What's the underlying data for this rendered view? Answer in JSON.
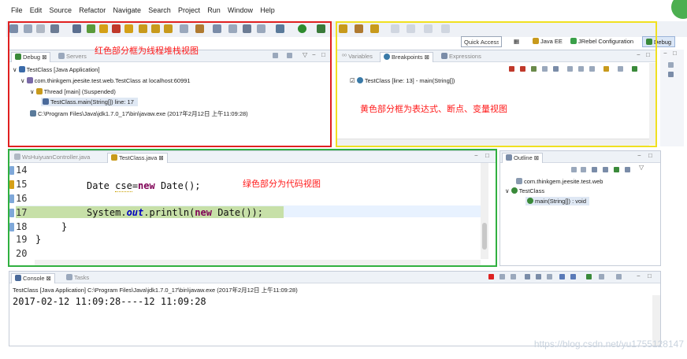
{
  "menu": [
    "File",
    "Edit",
    "Source",
    "Refactor",
    "Navigate",
    "Search",
    "Project",
    "Run",
    "Window",
    "Help"
  ],
  "toolbar": {
    "quick_access": "Quick Access",
    "perspectives": [
      "Java EE",
      "JRebel Configuration",
      "Debug"
    ]
  },
  "annotations": {
    "red": "红色部分框为线程堆栈视图",
    "yellow": "黄色部分框为表达式、断点、变量视图",
    "green": "绿色部分为代码视图"
  },
  "debug_view": {
    "tabs": [
      "Debug",
      "Servers"
    ],
    "tree": [
      "TestClass [Java Application]",
      "com.thinkgem.jeesite.test.web.TestClass at localhost:60991",
      "Thread [main] (Suspended)",
      "TestClass.main(String[]) line: 17",
      "C:\\Program Files\\Java\\jdk1.7.0_17\\bin\\javaw.exe (2017年2月12日 上午11:09:28)"
    ]
  },
  "variables_view": {
    "tabs": [
      "Variables",
      "Breakpoints",
      "Expressions"
    ],
    "breakpoint": "TestClass [line: 13] - main(String[])"
  },
  "editor": {
    "tabs": [
      "WsHuiyuanController.java",
      "TestClass.java"
    ],
    "line_numbers": [
      "14",
      "15",
      "16",
      "17",
      "18",
      "19",
      "20"
    ],
    "lines": {
      "l15_type": "Date ",
      "l15_var": "cse",
      "l15_eq": "=",
      "l15_new": "new",
      "l15_rest": " Date();",
      "l17_pre": "System.",
      "l17_out": "out",
      "l17_mid": ".println(",
      "l17_new": "new",
      "l17_rest": " Date());",
      "l18": "}",
      "l19": "}"
    }
  },
  "outline": {
    "tab": "Outline",
    "items": [
      "com.thinkgem.jeesite.test.web",
      "TestClass",
      "main(String[]) : void"
    ]
  },
  "console": {
    "tabs": [
      "Console",
      "Tasks"
    ],
    "header": "TestClass [Java Application] C:\\Program Files\\Java\\jdk1.7.0_17\\bin\\javaw.exe (2017年2月12日 上午11:09:28)",
    "output": "2017-02-12 11:09:28----12 11:09:28"
  },
  "watermark": "https://blog.csdn.net/yu1755128147",
  "colors": {
    "red_box": "#e02020",
    "yellow_box": "#f0e020",
    "green_box": "#30b040",
    "annotation": "#ff1a1a"
  }
}
